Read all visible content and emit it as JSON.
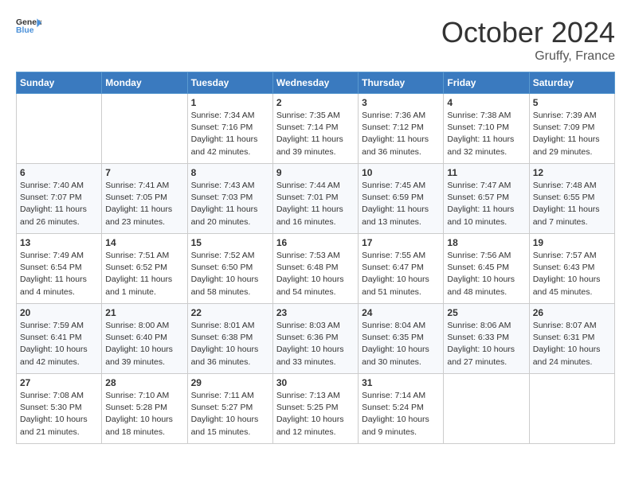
{
  "header": {
    "logo_general": "General",
    "logo_blue": "Blue",
    "month_year": "October 2024",
    "location": "Gruffy, France"
  },
  "days_of_week": [
    "Sunday",
    "Monday",
    "Tuesday",
    "Wednesday",
    "Thursday",
    "Friday",
    "Saturday"
  ],
  "weeks": [
    [
      {
        "day": "",
        "sunrise": "",
        "sunset": "",
        "daylight": ""
      },
      {
        "day": "",
        "sunrise": "",
        "sunset": "",
        "daylight": ""
      },
      {
        "day": "1",
        "sunrise": "Sunrise: 7:34 AM",
        "sunset": "Sunset: 7:16 PM",
        "daylight": "Daylight: 11 hours and 42 minutes."
      },
      {
        "day": "2",
        "sunrise": "Sunrise: 7:35 AM",
        "sunset": "Sunset: 7:14 PM",
        "daylight": "Daylight: 11 hours and 39 minutes."
      },
      {
        "day": "3",
        "sunrise": "Sunrise: 7:36 AM",
        "sunset": "Sunset: 7:12 PM",
        "daylight": "Daylight: 11 hours and 36 minutes."
      },
      {
        "day": "4",
        "sunrise": "Sunrise: 7:38 AM",
        "sunset": "Sunset: 7:10 PM",
        "daylight": "Daylight: 11 hours and 32 minutes."
      },
      {
        "day": "5",
        "sunrise": "Sunrise: 7:39 AM",
        "sunset": "Sunset: 7:09 PM",
        "daylight": "Daylight: 11 hours and 29 minutes."
      }
    ],
    [
      {
        "day": "6",
        "sunrise": "Sunrise: 7:40 AM",
        "sunset": "Sunset: 7:07 PM",
        "daylight": "Daylight: 11 hours and 26 minutes."
      },
      {
        "day": "7",
        "sunrise": "Sunrise: 7:41 AM",
        "sunset": "Sunset: 7:05 PM",
        "daylight": "Daylight: 11 hours and 23 minutes."
      },
      {
        "day": "8",
        "sunrise": "Sunrise: 7:43 AM",
        "sunset": "Sunset: 7:03 PM",
        "daylight": "Daylight: 11 hours and 20 minutes."
      },
      {
        "day": "9",
        "sunrise": "Sunrise: 7:44 AM",
        "sunset": "Sunset: 7:01 PM",
        "daylight": "Daylight: 11 hours and 16 minutes."
      },
      {
        "day": "10",
        "sunrise": "Sunrise: 7:45 AM",
        "sunset": "Sunset: 6:59 PM",
        "daylight": "Daylight: 11 hours and 13 minutes."
      },
      {
        "day": "11",
        "sunrise": "Sunrise: 7:47 AM",
        "sunset": "Sunset: 6:57 PM",
        "daylight": "Daylight: 11 hours and 10 minutes."
      },
      {
        "day": "12",
        "sunrise": "Sunrise: 7:48 AM",
        "sunset": "Sunset: 6:55 PM",
        "daylight": "Daylight: 11 hours and 7 minutes."
      }
    ],
    [
      {
        "day": "13",
        "sunrise": "Sunrise: 7:49 AM",
        "sunset": "Sunset: 6:54 PM",
        "daylight": "Daylight: 11 hours and 4 minutes."
      },
      {
        "day": "14",
        "sunrise": "Sunrise: 7:51 AM",
        "sunset": "Sunset: 6:52 PM",
        "daylight": "Daylight: 11 hours and 1 minute."
      },
      {
        "day": "15",
        "sunrise": "Sunrise: 7:52 AM",
        "sunset": "Sunset: 6:50 PM",
        "daylight": "Daylight: 10 hours and 58 minutes."
      },
      {
        "day": "16",
        "sunrise": "Sunrise: 7:53 AM",
        "sunset": "Sunset: 6:48 PM",
        "daylight": "Daylight: 10 hours and 54 minutes."
      },
      {
        "day": "17",
        "sunrise": "Sunrise: 7:55 AM",
        "sunset": "Sunset: 6:47 PM",
        "daylight": "Daylight: 10 hours and 51 minutes."
      },
      {
        "day": "18",
        "sunrise": "Sunrise: 7:56 AM",
        "sunset": "Sunset: 6:45 PM",
        "daylight": "Daylight: 10 hours and 48 minutes."
      },
      {
        "day": "19",
        "sunrise": "Sunrise: 7:57 AM",
        "sunset": "Sunset: 6:43 PM",
        "daylight": "Daylight: 10 hours and 45 minutes."
      }
    ],
    [
      {
        "day": "20",
        "sunrise": "Sunrise: 7:59 AM",
        "sunset": "Sunset: 6:41 PM",
        "daylight": "Daylight: 10 hours and 42 minutes."
      },
      {
        "day": "21",
        "sunrise": "Sunrise: 8:00 AM",
        "sunset": "Sunset: 6:40 PM",
        "daylight": "Daylight: 10 hours and 39 minutes."
      },
      {
        "day": "22",
        "sunrise": "Sunrise: 8:01 AM",
        "sunset": "Sunset: 6:38 PM",
        "daylight": "Daylight: 10 hours and 36 minutes."
      },
      {
        "day": "23",
        "sunrise": "Sunrise: 8:03 AM",
        "sunset": "Sunset: 6:36 PM",
        "daylight": "Daylight: 10 hours and 33 minutes."
      },
      {
        "day": "24",
        "sunrise": "Sunrise: 8:04 AM",
        "sunset": "Sunset: 6:35 PM",
        "daylight": "Daylight: 10 hours and 30 minutes."
      },
      {
        "day": "25",
        "sunrise": "Sunrise: 8:06 AM",
        "sunset": "Sunset: 6:33 PM",
        "daylight": "Daylight: 10 hours and 27 minutes."
      },
      {
        "day": "26",
        "sunrise": "Sunrise: 8:07 AM",
        "sunset": "Sunset: 6:31 PM",
        "daylight": "Daylight: 10 hours and 24 minutes."
      }
    ],
    [
      {
        "day": "27",
        "sunrise": "Sunrise: 7:08 AM",
        "sunset": "Sunset: 5:30 PM",
        "daylight": "Daylight: 10 hours and 21 minutes."
      },
      {
        "day": "28",
        "sunrise": "Sunrise: 7:10 AM",
        "sunset": "Sunset: 5:28 PM",
        "daylight": "Daylight: 10 hours and 18 minutes."
      },
      {
        "day": "29",
        "sunrise": "Sunrise: 7:11 AM",
        "sunset": "Sunset: 5:27 PM",
        "daylight": "Daylight: 10 hours and 15 minutes."
      },
      {
        "day": "30",
        "sunrise": "Sunrise: 7:13 AM",
        "sunset": "Sunset: 5:25 PM",
        "daylight": "Daylight: 10 hours and 12 minutes."
      },
      {
        "day": "31",
        "sunrise": "Sunrise: 7:14 AM",
        "sunset": "Sunset: 5:24 PM",
        "daylight": "Daylight: 10 hours and 9 minutes."
      },
      {
        "day": "",
        "sunrise": "",
        "sunset": "",
        "daylight": ""
      },
      {
        "day": "",
        "sunrise": "",
        "sunset": "",
        "daylight": ""
      }
    ]
  ]
}
